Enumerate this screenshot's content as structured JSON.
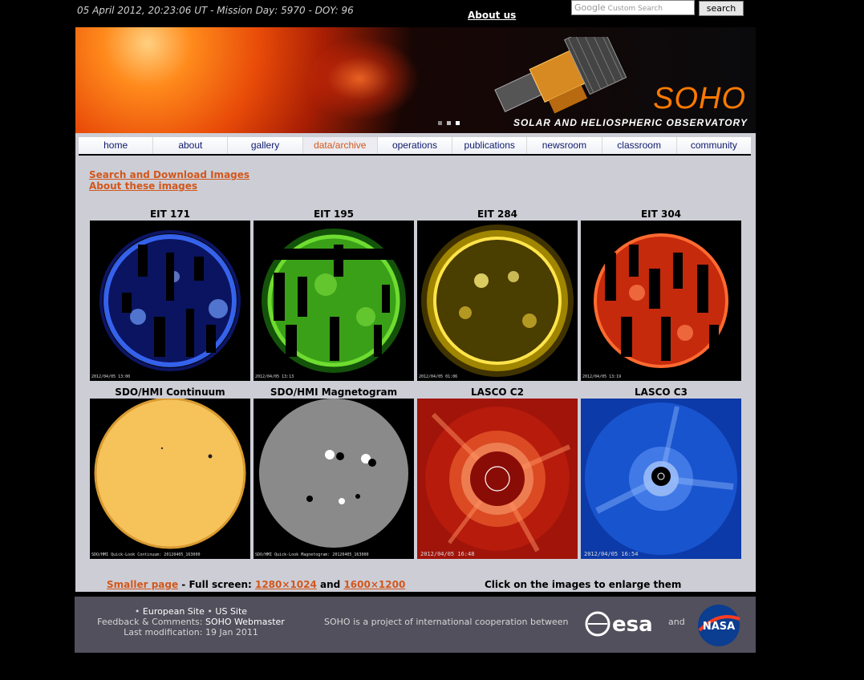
{
  "top": {
    "datetime": "05 April 2012, 20:23:06 UT - Mission Day: 5970 - DOY: 96",
    "about_us": "About us",
    "search_placeholder": "Custom Search",
    "search_brand": "Google",
    "search_button": "search"
  },
  "banner": {
    "logo": "SOHO",
    "subtitle": "SOLAR AND HELIOSPHERIC OBSERVATORY"
  },
  "nav": {
    "items": [
      "home",
      "about",
      "gallery",
      "data/archive",
      "operations",
      "publications",
      "newsroom",
      "classroom",
      "community"
    ],
    "active_index": 3
  },
  "links": {
    "search_download": "Search and Download Images",
    "about_images": "About these images"
  },
  "images": [
    {
      "title": "EIT 171",
      "timestamp": "2012/04/05 13:00",
      "color": "#2a4bff"
    },
    {
      "title": "EIT 195",
      "timestamp": "2012/04/05 13:13",
      "color": "#3dbd16"
    },
    {
      "title": "EIT 284",
      "timestamp": "2012/04/05 01:06",
      "color": "#d8b600"
    },
    {
      "title": "EIT 304",
      "timestamp": "2012/04/05 13:19",
      "color": "#ff3a14"
    },
    {
      "title": "SDO/HMI Continuum",
      "timestamp": "SDO/HMI Quick-Look Continuum: 20120405_163000",
      "color": "#f7c45a"
    },
    {
      "title": "SDO/HMI Magnetogram",
      "timestamp": "SDO/HMI Quick-Look Magnetogram: 20120405_163000",
      "color": "#8c8c8c"
    },
    {
      "title": "LASCO C2",
      "timestamp": "2012/04/05 16:48",
      "color": "#b5150c"
    },
    {
      "title": "LASCO C3",
      "timestamp": "2012/04/05 16:54",
      "color": "#1a52d6"
    }
  ],
  "bottom": {
    "smaller_page": "Smaller page",
    "full_screen_label": " - Full screen: ",
    "res1": "1280×1024",
    "and": " and ",
    "res2": "1600×1200",
    "enlarge_hint": "Click on the images to enlarge them"
  },
  "footer": {
    "bullet": "•",
    "european_site": "European Site",
    "us_site": "US Site",
    "feedback_label": "Feedback & Comments: ",
    "webmaster": "SOHO Webmaster",
    "last_mod": "Last modification: 19 Jan 2011",
    "coop_text": "SOHO is a project of international cooperation between",
    "and": "and",
    "esa": "esa",
    "nasa": "NASA"
  }
}
